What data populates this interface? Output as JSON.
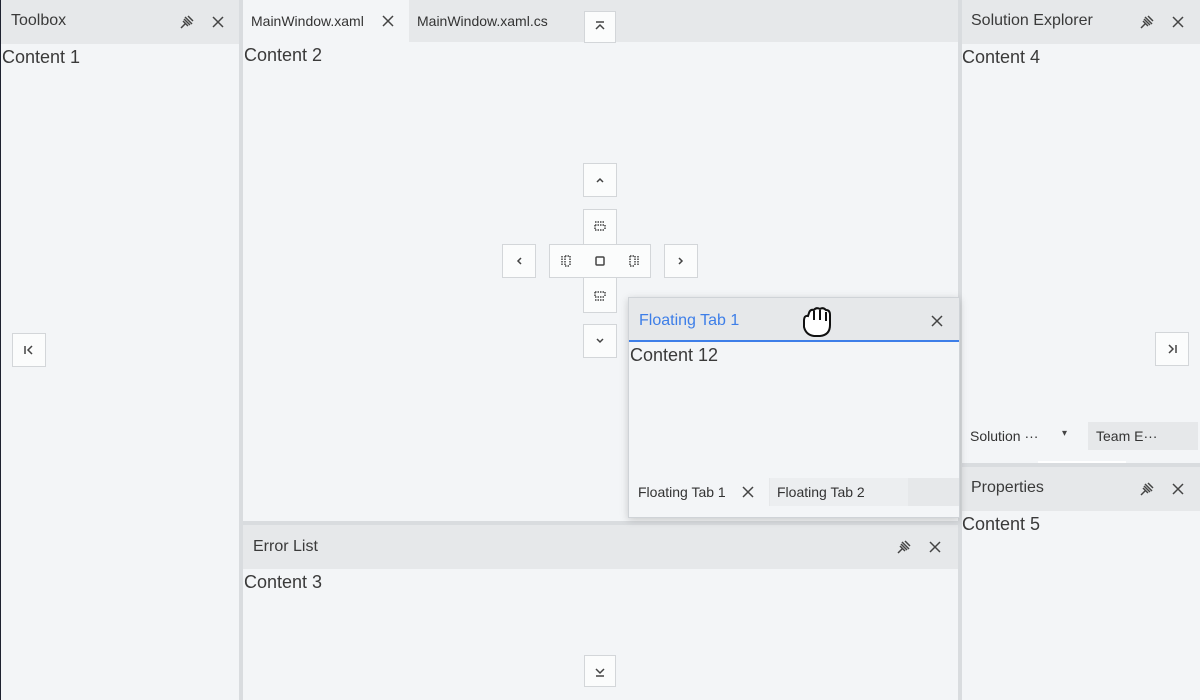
{
  "toolbox": {
    "title": "Toolbox",
    "content": "Content 1"
  },
  "document": {
    "tabs": [
      {
        "label": "MainWindow.xaml",
        "active": true
      },
      {
        "label": "MainWindow.xaml.cs",
        "active": false
      }
    ],
    "content": "Content 2"
  },
  "error_list": {
    "title": "Error List",
    "content": "Content 3"
  },
  "solution_explorer": {
    "title": "Solution Explorer",
    "content": "Content 4",
    "bottom_tabs": [
      {
        "label": "Solution ···"
      },
      {
        "label": "Team E···"
      }
    ]
  },
  "properties": {
    "title": "Properties",
    "content": "Content 5"
  },
  "floating_window": {
    "title": "Floating Tab 1",
    "content": "Content 12",
    "tabs": [
      {
        "label": "Floating Tab 1"
      },
      {
        "label": "Floating Tab 2"
      }
    ]
  },
  "colors": {
    "accent": "#3d7ee8",
    "panel_bg": "#f3f5f7",
    "header_bg": "#e6e8ea"
  }
}
